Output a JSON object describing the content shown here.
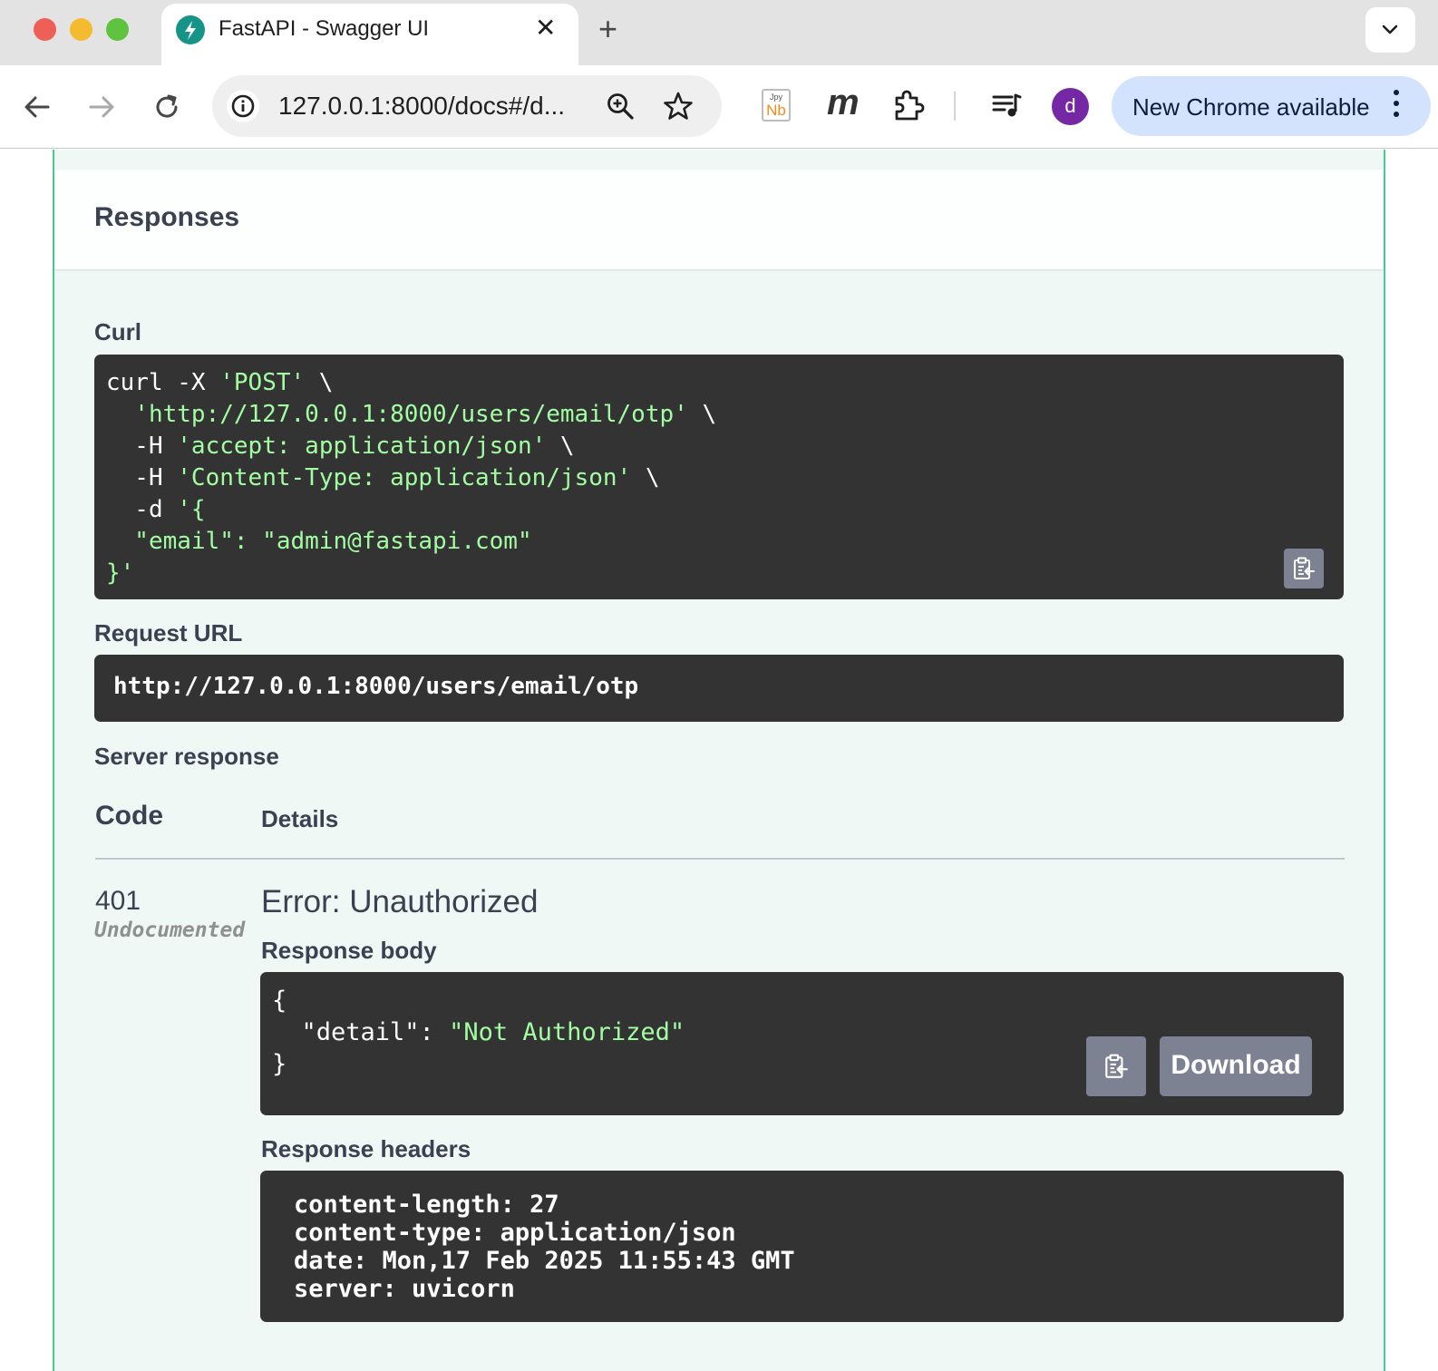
{
  "browser": {
    "tab_title": "FastAPI - Swagger UI",
    "address_bar": "127.0.0.1:8000/docs#/d...",
    "extension_nb_top": "Jpy",
    "extension_nb_bottom": "Nb",
    "extension_m": "m",
    "avatar_letter": "d",
    "update_chip_label": "New Chrome available"
  },
  "responses": {
    "section_title": "Responses",
    "curl_label": "Curl",
    "curl": {
      "line1_cmd": "curl -X ",
      "line1_method": "'POST'",
      "line1_tail": " \\",
      "line2_url": "  'http://127.0.0.1:8000/users/email/otp'",
      "line2_tail": " \\",
      "line3_flag": "  -H ",
      "line3_val": "'accept: application/json'",
      "line3_tail": " \\",
      "line4_flag": "  -H ",
      "line4_val": "'Content-Type: application/json'",
      "line4_tail": " \\",
      "line5_flag": "  -d ",
      "line5_val": "'{",
      "line6": "  \"email\": \"admin@fastapi.com\"",
      "line7": "}'"
    },
    "request_url_label": "Request URL",
    "request_url": "http://127.0.0.1:8000/users/email/otp",
    "server_response_label": "Server response",
    "table": {
      "code_header": "Code",
      "details_header": "Details"
    },
    "row": {
      "code": "401",
      "undocumented": "Undocumented",
      "error_title": "Error: Unauthorized",
      "response_body_label": "Response body",
      "body": {
        "open": "{",
        "key": "  \"detail\": ",
        "value": "\"Not Authorized\"",
        "close": "}"
      },
      "download_label": "Download",
      "response_headers_label": "Response headers",
      "headers": [
        "content-length: 27",
        "content-type: application/json",
        "date: Mon,17 Feb 2025 11:55:43 GMT",
        "server: uvicorn"
      ]
    }
  },
  "colors": {
    "post_accent": "#49cc90",
    "code_bg": "#333333",
    "string_green": "#a2fca2",
    "chrome_update_chip": "#d3e3fd",
    "avatar": "#7627a3"
  },
  "icons": [
    "fastapi-favicon-icon",
    "close-icon",
    "plus-icon",
    "chevron-down-icon",
    "back-arrow-icon",
    "forward-arrow-icon",
    "reload-icon",
    "info-icon",
    "zoom-icon",
    "star-icon",
    "puzzle-icon",
    "media-queue-icon",
    "kebab-menu-icon",
    "clipboard-copy-icon"
  ]
}
